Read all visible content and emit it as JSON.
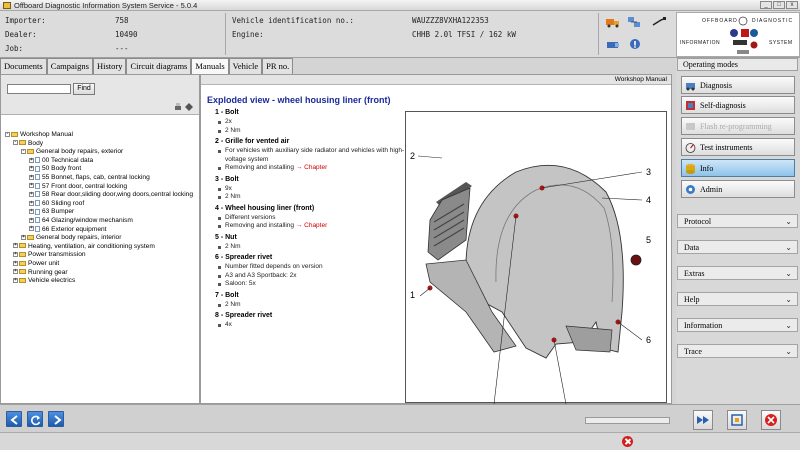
{
  "window": {
    "title": "Offboard Diagnostic Information System Service - 5.0.4"
  },
  "info": {
    "importer_label": "Importer:",
    "importer_value": "758",
    "dealer_label": "Dealer:",
    "dealer_value": "10490",
    "job_label": "Job:",
    "job_value": "---",
    "vin_label": "Vehicle identification no.:",
    "vin_value": "WAUZZZ8VXHA122353",
    "engine_label": "Engine:",
    "engine_value": "CHHB 2.0l TFSI / 162 kW"
  },
  "logo": {
    "line1": "OFFBOARD",
    "line2": "DIAGNOSTIC",
    "line3": "INFORMATION",
    "line4": "SYSTEM"
  },
  "tabs": [
    {
      "label": "Documents"
    },
    {
      "label": "Campaigns"
    },
    {
      "label": "History"
    },
    {
      "label": "Circuit diagrams"
    },
    {
      "label": "Manuals"
    },
    {
      "label": "Vehicle"
    },
    {
      "label": "PR no."
    }
  ],
  "search": {
    "placeholder": "",
    "find_label": "Find"
  },
  "tree": [
    {
      "level": 0,
      "exp": "-",
      "kind": "folder",
      "label": "Workshop Manual"
    },
    {
      "level": 1,
      "exp": "-",
      "kind": "folder",
      "label": "Body"
    },
    {
      "level": 2,
      "exp": "-",
      "kind": "folder",
      "label": "General body repairs, exterior"
    },
    {
      "level": 3,
      "exp": "+",
      "kind": "doc",
      "label": "00 Technical data"
    },
    {
      "level": 3,
      "exp": "+",
      "kind": "doc",
      "label": "50 Body front"
    },
    {
      "level": 3,
      "exp": "+",
      "kind": "doc",
      "label": "55 Bonnet, flaps, cab, central locking"
    },
    {
      "level": 3,
      "exp": "+",
      "kind": "doc",
      "label": "57 Front door, central locking"
    },
    {
      "level": 3,
      "exp": "+",
      "kind": "doc",
      "label": "58 Rear door,sliding door,wing doors,central locking"
    },
    {
      "level": 3,
      "exp": "+",
      "kind": "doc",
      "label": "60 Sliding roof"
    },
    {
      "level": 3,
      "exp": "+",
      "kind": "doc",
      "label": "63 Bumper"
    },
    {
      "level": 3,
      "exp": "+",
      "kind": "doc",
      "label": "64 Glazing/window mechanism"
    },
    {
      "level": 3,
      "exp": "+",
      "kind": "doc",
      "label": "66 Exterior equipment"
    },
    {
      "level": 2,
      "exp": "+",
      "kind": "folder",
      "label": "General body repairs, interior"
    },
    {
      "level": 1,
      "exp": "+",
      "kind": "folder",
      "label": "Heating, ventilation, air conditioning system"
    },
    {
      "level": 1,
      "exp": "+",
      "kind": "folder",
      "label": "Power transmission"
    },
    {
      "level": 1,
      "exp": "+",
      "kind": "folder",
      "label": "Power unit"
    },
    {
      "level": 1,
      "exp": "+",
      "kind": "folder",
      "label": "Running gear"
    },
    {
      "level": 1,
      "exp": "+",
      "kind": "folder",
      "label": "Vehicle electrics"
    }
  ],
  "doc": {
    "header": "Workshop Manual",
    "title": "Exploded view - wheel housing liner (front)",
    "parts": [
      {
        "title": "1 - Bolt",
        "details": [
          {
            "text": "2x"
          },
          {
            "text": "2 Nm"
          }
        ]
      },
      {
        "title": "2 - Grille for vented air",
        "details": [
          {
            "text": "For vehicles with auxiliary side radiator and vehicles with high-voltage system"
          },
          {
            "text": "Removing and installing ",
            "link": "→ Chapter"
          }
        ]
      },
      {
        "title": "3 - Bolt",
        "details": [
          {
            "text": "9x"
          },
          {
            "text": "2 Nm"
          }
        ]
      },
      {
        "title": "4 - Wheel housing liner (front)",
        "details": [
          {
            "text": "Different versions"
          },
          {
            "text": "Removing and installing ",
            "link": "→ Chapter"
          }
        ]
      },
      {
        "title": "5 - Nut",
        "details": [
          {
            "text": "2 Nm"
          }
        ]
      },
      {
        "title": "6 - Spreader rivet",
        "details": [
          {
            "text": "Number fitted depends on version"
          },
          {
            "text": "A3 and A3 Sportback: 2x"
          },
          {
            "text": "Saloon: 5x"
          }
        ]
      },
      {
        "title": "7 - Bolt",
        "details": [
          {
            "text": "2 Nm"
          }
        ]
      },
      {
        "title": "8 - Spreader rivet",
        "details": [
          {
            "text": "4x"
          }
        ]
      }
    ],
    "callouts": [
      "1",
      "2",
      "3",
      "4",
      "5",
      "6"
    ]
  },
  "operating": {
    "header": "Operating modes",
    "buttons": [
      {
        "label": "Diagnosis",
        "state": "normal"
      },
      {
        "label": "Self-diagnosis",
        "state": "normal"
      },
      {
        "label": "Flash re-programming",
        "state": "disabled"
      },
      {
        "label": "Test instruments",
        "state": "normal"
      },
      {
        "label": "Info",
        "state": "selected"
      },
      {
        "label": "Admin",
        "state": "normal"
      }
    ],
    "sections": [
      {
        "label": "Protocol"
      },
      {
        "label": "Data"
      },
      {
        "label": "Extras"
      },
      {
        "label": "Help"
      },
      {
        "label": "Information"
      },
      {
        "label": "Trace"
      }
    ]
  },
  "colors": {
    "accent_blue": "#1e5bb0",
    "link_red": "#d00000",
    "title_blue": "#1a2a9a",
    "error_red": "#d41e1e"
  }
}
